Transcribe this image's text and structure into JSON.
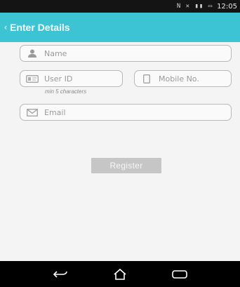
{
  "status_bar": {
    "icons": "N ✕ ▮▮ ▭",
    "time": "12:05"
  },
  "action_bar": {
    "title": "Enter Details"
  },
  "form": {
    "name": {
      "placeholder": "Name",
      "icon": "person-icon"
    },
    "user_id": {
      "placeholder": "User ID",
      "icon": "id-card-icon",
      "hint": "min 5 characters"
    },
    "mobile": {
      "placeholder": "Mobile No.",
      "icon": "mobile-phone-icon"
    },
    "email": {
      "placeholder": "Email",
      "icon": "envelope-icon"
    },
    "register_label": "Register"
  },
  "nav_bar": {
    "items": [
      "back-icon",
      "home-icon",
      "recents-icon"
    ]
  },
  "colors": {
    "action_bar": "#3dc4d4",
    "button": "#c6c6c6",
    "field_border": "#b8b8b8"
  }
}
